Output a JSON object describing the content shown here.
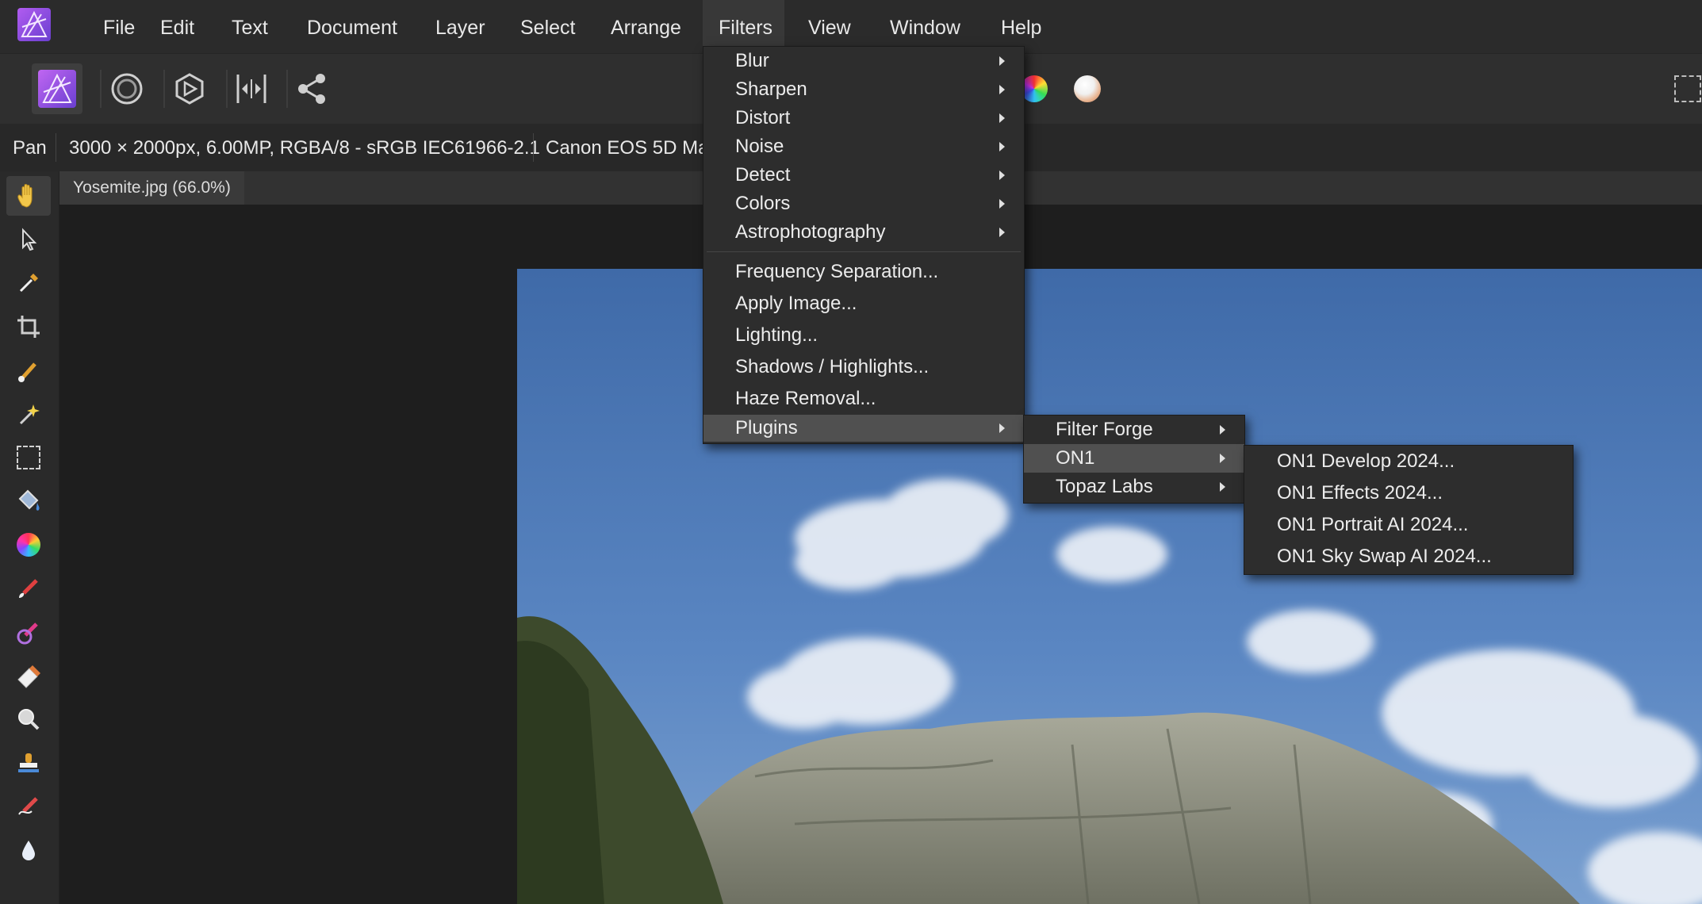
{
  "menubar": {
    "items": [
      "File",
      "Edit",
      "Text",
      "Document",
      "Layer",
      "Select",
      "Arrange",
      "Filters",
      "View",
      "Window",
      "Help"
    ],
    "open_item": "Filters"
  },
  "context": {
    "tool_name": "Pan",
    "doc_info": "3000 × 2000px, 6.00MP, RGBA/8 - sRGB IEC61966-2.1",
    "camera": "Canon EOS 5D Ma"
  },
  "document": {
    "tab_title": "Yosemite.jpg (66.0%)"
  },
  "filters_menu": {
    "group1": [
      "Blur",
      "Sharpen",
      "Distort",
      "Noise",
      "Detect",
      "Colors",
      "Astrophotography"
    ],
    "group2": [
      "Frequency Separation...",
      "Apply Image...",
      "Lighting...",
      "Shadows / Highlights...",
      "Haze Removal..."
    ],
    "plugins_label": "Plugins"
  },
  "plugins_menu": {
    "items": [
      "Filter Forge",
      "ON1",
      "Topaz Labs"
    ],
    "highlighted": "ON1"
  },
  "on1_menu": {
    "items": [
      "ON1 Develop 2024...",
      "ON1 Effects 2024...",
      "ON1 Portrait AI 2024...",
      "ON1 Sky Swap AI 2024..."
    ]
  },
  "colors": {
    "accent": "#8a4fd6",
    "highlight": "#505050",
    "menu_bg": "#2d2d2d"
  },
  "icons": {
    "toolbar": [
      "affinity-photo-persona-icon",
      "liquify-persona-icon",
      "develop-persona-icon",
      "tone-mapping-persona-icon",
      "export-persona-icon",
      "color-wheel-icon",
      "white-balance-icon",
      "marquee-icon"
    ],
    "tools": [
      "hand-icon",
      "pointer-icon",
      "color-picker-icon",
      "crop-icon",
      "selection-brush-icon",
      "flood-select-icon",
      "rectangular-marquee-icon",
      "flood-fill-icon",
      "color-wheel-tool-icon",
      "paint-brush-icon",
      "dodge-brush-icon",
      "eraser-icon",
      "zoom-icon",
      "clone-stamp-icon",
      "retouch-brush-icon",
      "blur-drop-icon"
    ]
  }
}
